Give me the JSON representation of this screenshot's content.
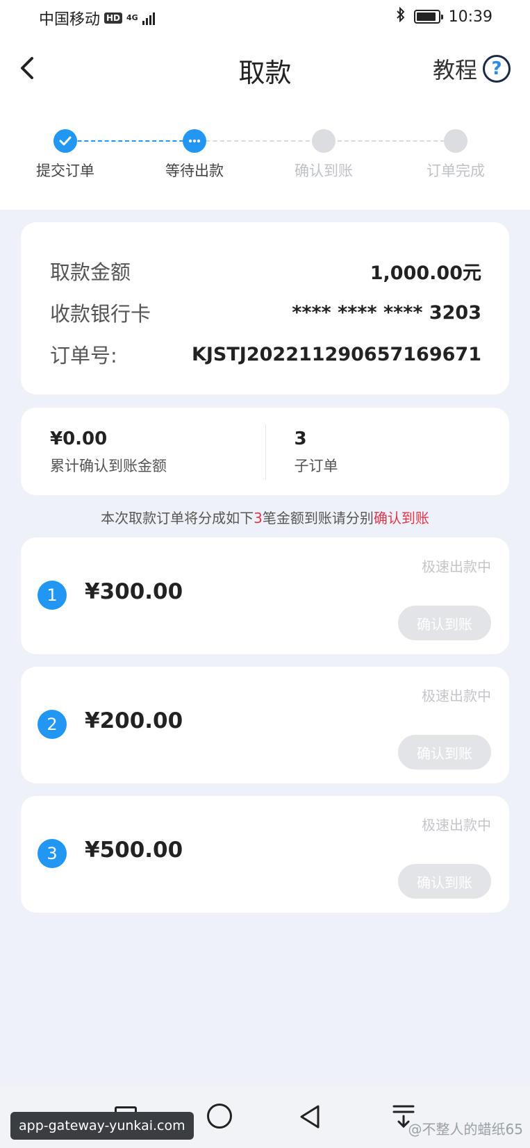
{
  "status_bar": {
    "carrier": "中国移动",
    "hd_badge": "HD",
    "network": "4G",
    "time": "10:39",
    "bluetooth_icon": "bluetooth-icon",
    "battery_level": 0.9
  },
  "header": {
    "title": "取款",
    "tutorial_label": "教程",
    "help_icon": "?"
  },
  "steps": [
    {
      "label": "提交订单",
      "state": "done"
    },
    {
      "label": "等待出款",
      "state": "active"
    },
    {
      "label": "确认到账",
      "state": "todo"
    },
    {
      "label": "订单完成",
      "state": "todo"
    }
  ],
  "info": {
    "amount_label": "取款金额",
    "amount_value": "1,000.00元",
    "card_label": "收款银行卡",
    "card_value": "**** **** **** 3203",
    "order_label": "订单号:",
    "order_value": "KJSTJ20221129065716967​1"
  },
  "summary": {
    "confirmed_value": "¥0.00",
    "confirmed_label": "累计确认到账金额",
    "suborders_value": "3",
    "suborders_label": "子订单"
  },
  "notice": {
    "prefix": "本次取款订单将分成如下",
    "count": "3",
    "middle": "笔金额到账请分别",
    "highlight": "确认到账"
  },
  "orders": [
    {
      "index": "1",
      "amount": "¥300.00",
      "status": "极速出款中",
      "button": "确认到账"
    },
    {
      "index": "2",
      "amount": "¥200.00",
      "status": "极速出款中",
      "button": "确认到账"
    },
    {
      "index": "3",
      "amount": "¥500.00",
      "status": "极速出款中",
      "button": "确认到账"
    }
  ],
  "overlay": {
    "url": "app-gateway-yunkai.com",
    "watermark": "@不整人的蜡纸65"
  },
  "colors": {
    "accent": "#2196f3",
    "highlight": "#e0344a",
    "disabled_button": "#e3e4e7"
  }
}
